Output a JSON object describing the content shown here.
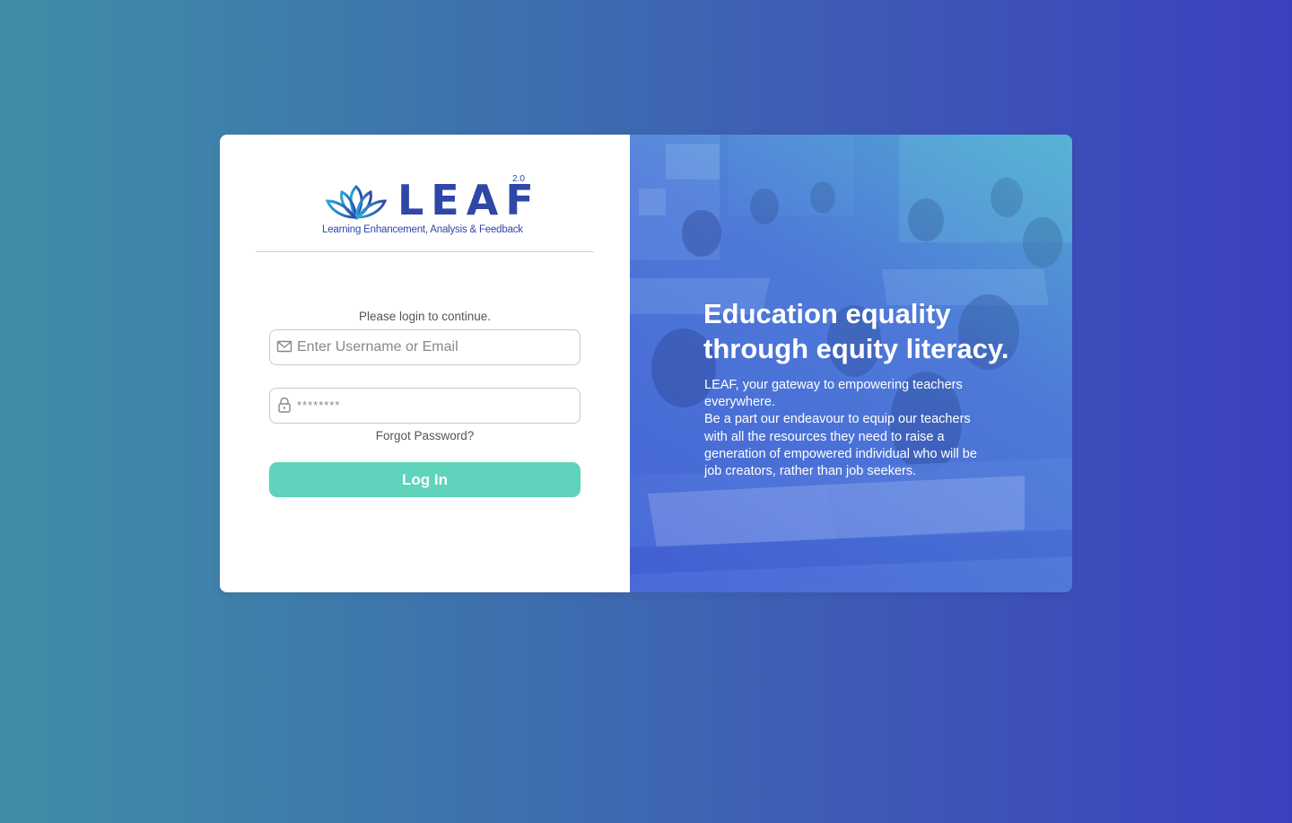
{
  "logo": {
    "word": "LEAF",
    "version": "2.0",
    "tagline": "Learning Enhancement, Analysis & Feedback"
  },
  "login": {
    "prompt": "Please login to continue.",
    "username_placeholder": "Enter Username or Email",
    "username_value": "",
    "password_placeholder": "********",
    "password_value": "",
    "forgot_label": "Forgot Password?",
    "login_label": "Log In"
  },
  "hero": {
    "title": "Education equality through equity literacy.",
    "desc_1": "LEAF, your gateway to empowering teachers everywhere.",
    "desc_2": "Be a part our endeavour to equip our teachers with all the resources they need to raise a generation of empowered individual who will be job creators, rather than job seekers."
  },
  "colors": {
    "brand": "#2f47a6",
    "button": "#5fd3bb",
    "accent_teal": "#55d6cf",
    "accent_blue": "#3d40be"
  },
  "icons": {
    "username": "mail-icon",
    "password": "lock-icon",
    "logo": "lotus-icon"
  }
}
